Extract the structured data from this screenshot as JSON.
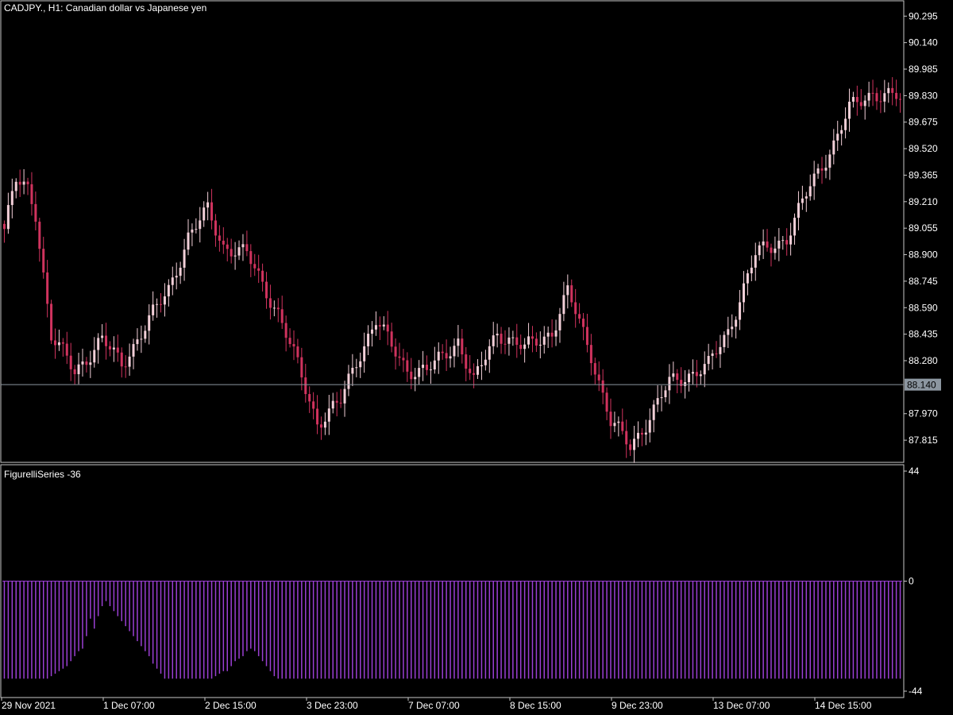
{
  "header": {
    "symbol_caption": "CADJPY., H1:  Canadian dollar vs Japanese yen"
  },
  "indicator": {
    "caption": "FigurelliSeries -36"
  },
  "colors": {
    "background": "#000000",
    "frame": "#c8c8c8",
    "candle_bear": "#d0335e",
    "candle_bull_body": "#f2cfd8",
    "candle_bull_green": "#2ecc40",
    "histogram": "#9b3fd4",
    "price_line": "#8c96a0",
    "price_tag_bg": "#8c96a0"
  },
  "chart_data": [
    {
      "type": "candlestick",
      "title": "CADJPY., H1:  Canadian dollar vs Japanese yen",
      "y_ticks": [
        "90.295",
        "90.140",
        "89.985",
        "89.830",
        "89.675",
        "89.520",
        "89.365",
        "89.210",
        "89.055",
        "88.900",
        "88.745",
        "88.590",
        "88.435",
        "88.280",
        "87.970",
        "87.815"
      ],
      "ylim": [
        87.69,
        90.38
      ],
      "current_price": "88.140",
      "current_price_value": 88.14,
      "x_ticks": [
        "29 Nov 2021",
        "1 Dec 07:00",
        "2 Dec 15:00",
        "3 Dec 23:00",
        "7 Dec 07:00",
        "8 Dec 15:00",
        "9 Dec 23:00",
        "13 Dec 07:00",
        "14 Dec 15:00"
      ],
      "bar_count": 230,
      "close_anchors": [
        [
          0,
          89.05
        ],
        [
          3,
          89.33
        ],
        [
          6,
          89.28
        ],
        [
          8,
          89.15
        ],
        [
          12,
          88.42
        ],
        [
          18,
          88.22
        ],
        [
          25,
          88.4
        ],
        [
          30,
          88.26
        ],
        [
          38,
          88.55
        ],
        [
          42,
          88.7
        ],
        [
          47,
          89.0
        ],
        [
          52,
          89.16
        ],
        [
          56,
          88.95
        ],
        [
          62,
          88.9
        ],
        [
          66,
          88.73
        ],
        [
          70,
          88.56
        ],
        [
          75,
          88.25
        ],
        [
          80,
          87.92
        ],
        [
          86,
          88.04
        ],
        [
          90,
          88.28
        ],
        [
          95,
          88.52
        ],
        [
          99,
          88.36
        ],
        [
          103,
          88.23
        ],
        [
          108,
          88.22
        ],
        [
          112,
          88.3
        ],
        [
          116,
          88.4
        ],
        [
          120,
          88.15
        ],
        [
          126,
          88.45
        ],
        [
          133,
          88.35
        ],
        [
          140,
          88.45
        ],
        [
          144,
          88.68
        ],
        [
          150,
          88.32
        ],
        [
          155,
          87.92
        ],
        [
          160,
          87.78
        ],
        [
          165,
          87.95
        ],
        [
          170,
          88.15
        ],
        [
          180,
          88.25
        ],
        [
          185,
          88.45
        ],
        [
          192,
          88.9
        ],
        [
          200,
          89.0
        ],
        [
          206,
          89.3
        ],
        [
          212,
          89.55
        ],
        [
          216,
          89.75
        ],
        [
          222,
          89.85
        ],
        [
          228,
          89.82
        ],
        [
          230,
          89.78
        ]
      ]
    },
    {
      "type": "bar",
      "title": "FigurelliSeries -36",
      "y_ticks": [
        "44",
        "0",
        "-44"
      ],
      "ylim": [
        -44,
        44
      ],
      "values": [
        -39,
        -39,
        -39,
        -39,
        -39,
        -39,
        -39,
        -39,
        -39,
        -39,
        -39,
        -39,
        -38,
        -37,
        -36,
        -35,
        -34,
        -32,
        -30,
        -28,
        -27,
        -22,
        -15,
        -19,
        -14,
        -10,
        -8,
        -10,
        -12,
        -14,
        -16,
        -18,
        -20,
        -22,
        -24,
        -26,
        -28,
        -30,
        -33,
        -35,
        -37,
        -39,
        -39,
        -39,
        -39,
        -39,
        -39,
        -39,
        -39,
        -39,
        -39,
        -39,
        -39,
        -39,
        -38,
        -37,
        -36,
        -36,
        -34,
        -32,
        -31,
        -30,
        -28,
        -27,
        -28,
        -30,
        -32,
        -34,
        -36,
        -38,
        -39,
        -39,
        -39,
        -39,
        -39,
        -39,
        -39,
        -39,
        -39,
        -39,
        -39,
        -39,
        -39,
        -39,
        -39,
        -39,
        -39,
        -39,
        -39,
        -39,
        -39,
        -39,
        -39,
        -39,
        -39,
        -39,
        -39,
        -39,
        -39,
        -39,
        -39,
        -39,
        -39,
        -39,
        -39,
        -39,
        -39,
        -39,
        -39,
        -39,
        -39,
        -39,
        -39,
        -39,
        -39,
        -39,
        -39,
        -39,
        -39,
        -39,
        -39,
        -39,
        -39,
        -39,
        -39,
        -39,
        -39,
        -39,
        -39,
        -39,
        -39,
        -39,
        -39,
        -39,
        -39,
        -39,
        -39,
        -39,
        -39,
        -39,
        -39,
        -39,
        -39,
        -39,
        -39,
        -39,
        -39,
        -39,
        -39,
        -39,
        -39,
        -39,
        -39,
        -39,
        -39,
        -39,
        -39,
        -39,
        -39,
        -39,
        -39,
        -39,
        -39,
        -39,
        -39,
        -39,
        -39,
        -39,
        -39,
        -39,
        -39,
        -39,
        -39,
        -39,
        -39,
        -39,
        -39,
        -39,
        -39,
        -39,
        -39,
        -39,
        -39,
        -39,
        -39,
        -39,
        -39,
        -39,
        -39,
        -39,
        -39,
        -39,
        -39,
        -39,
        -39,
        -39,
        -39,
        -39,
        -39,
        -39,
        -39,
        -39,
        -39,
        -39,
        -39,
        -39,
        -39,
        -39,
        -39,
        -39,
        -39,
        -39,
        -39,
        -39,
        -39,
        -39,
        -39,
        -39,
        -39,
        -39,
        -39,
        -39,
        -39,
        -39,
        -39,
        -39,
        -39,
        -39,
        -39,
        -39
      ]
    }
  ]
}
